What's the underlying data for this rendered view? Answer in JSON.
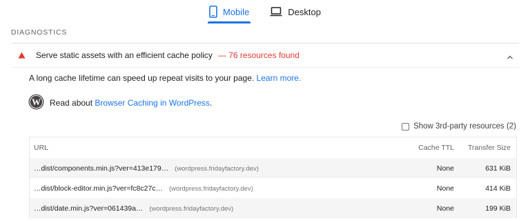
{
  "tabs": [
    {
      "label": "Mobile",
      "icon": "phone-icon",
      "active": true
    },
    {
      "label": "Desktop",
      "icon": "laptop-icon",
      "active": false
    }
  ],
  "section": {
    "title": "DIAGNOSTICS"
  },
  "audit": {
    "icon": "warning-triangle-icon",
    "title": "Serve static assets with an efficient cache policy",
    "display_value": "— 76 resources found",
    "description": "A long cache lifetime can speed up repeat visits to your page.",
    "learn_more": "Learn more.",
    "stack_pack": {
      "icon": "wordpress-icon",
      "prefix": "Read about",
      "link": "Browser Caching in WordPress",
      "suffix": "."
    },
    "third_party_label": "Show 3rd-party resources (2)",
    "third_party_checked": false
  },
  "table": {
    "headers": {
      "url": "URL",
      "ttl": "Cache TTL",
      "size": "Transfer Size"
    },
    "rows": [
      {
        "url": "…dist/components.min.js?ver=413e179…",
        "origin": "(wordpress.fridayfactory.dev)",
        "ttl": "None",
        "size": "631 KiB"
      },
      {
        "url": "…dist/block-editor.min.js?ver=fc8c27c…",
        "origin": "(wordpress.fridayfactory.dev)",
        "ttl": "None",
        "size": "414 KiB"
      },
      {
        "url": "…dist/date.min.js?ver=061439a…",
        "origin": "(wordpress.fridayfactory.dev)",
        "ttl": "None",
        "size": "199 KiB"
      }
    ]
  },
  "colors": {
    "accent": "#1a73e8",
    "warning": "#e53935"
  }
}
